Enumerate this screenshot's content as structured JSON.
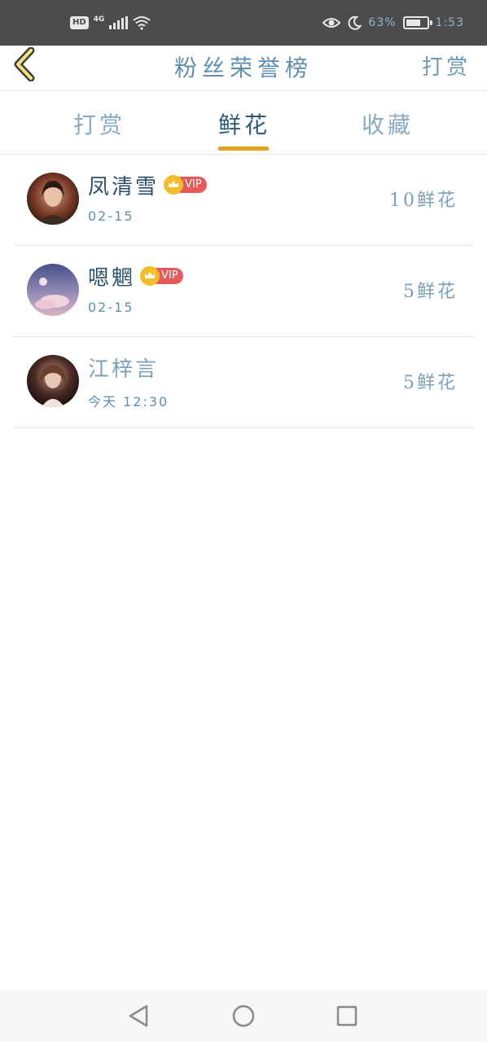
{
  "status_bar": {
    "hd_badge": "HD",
    "network_label": "4G",
    "battery_percent": "63%",
    "time": "1:53",
    "icons": [
      "hd-icon",
      "signal-icon",
      "wifi-icon",
      "eye-icon",
      "moon-icon",
      "battery-icon"
    ]
  },
  "header": {
    "back_icon": "chevron-left-icon",
    "title": "粉丝荣誉榜",
    "action_label": "打赏"
  },
  "tabs": [
    {
      "label": "打赏",
      "active": false
    },
    {
      "label": "鲜花",
      "active": true
    },
    {
      "label": "收藏",
      "active": false
    }
  ],
  "colors": {
    "accent": "#e4a11f",
    "text_primary": "#2c5a78",
    "vip_badge": "#e5595a",
    "crown": "#f3bd2a"
  },
  "fans": [
    {
      "name": "凤清雪",
      "vip": true,
      "vip_label": "VIP",
      "time": "02-15",
      "amount": "10鲜花"
    },
    {
      "name": "嗯魍",
      "vip": true,
      "vip_label": "VIP",
      "time": "02-15",
      "amount": "5鲜花"
    },
    {
      "name": "江梓言",
      "vip": false,
      "time": "今天 12:30",
      "amount": "5鲜花"
    }
  ],
  "nav_bar": {
    "icons": [
      "back-triangle-icon",
      "home-circle-icon",
      "recent-square-icon"
    ]
  }
}
